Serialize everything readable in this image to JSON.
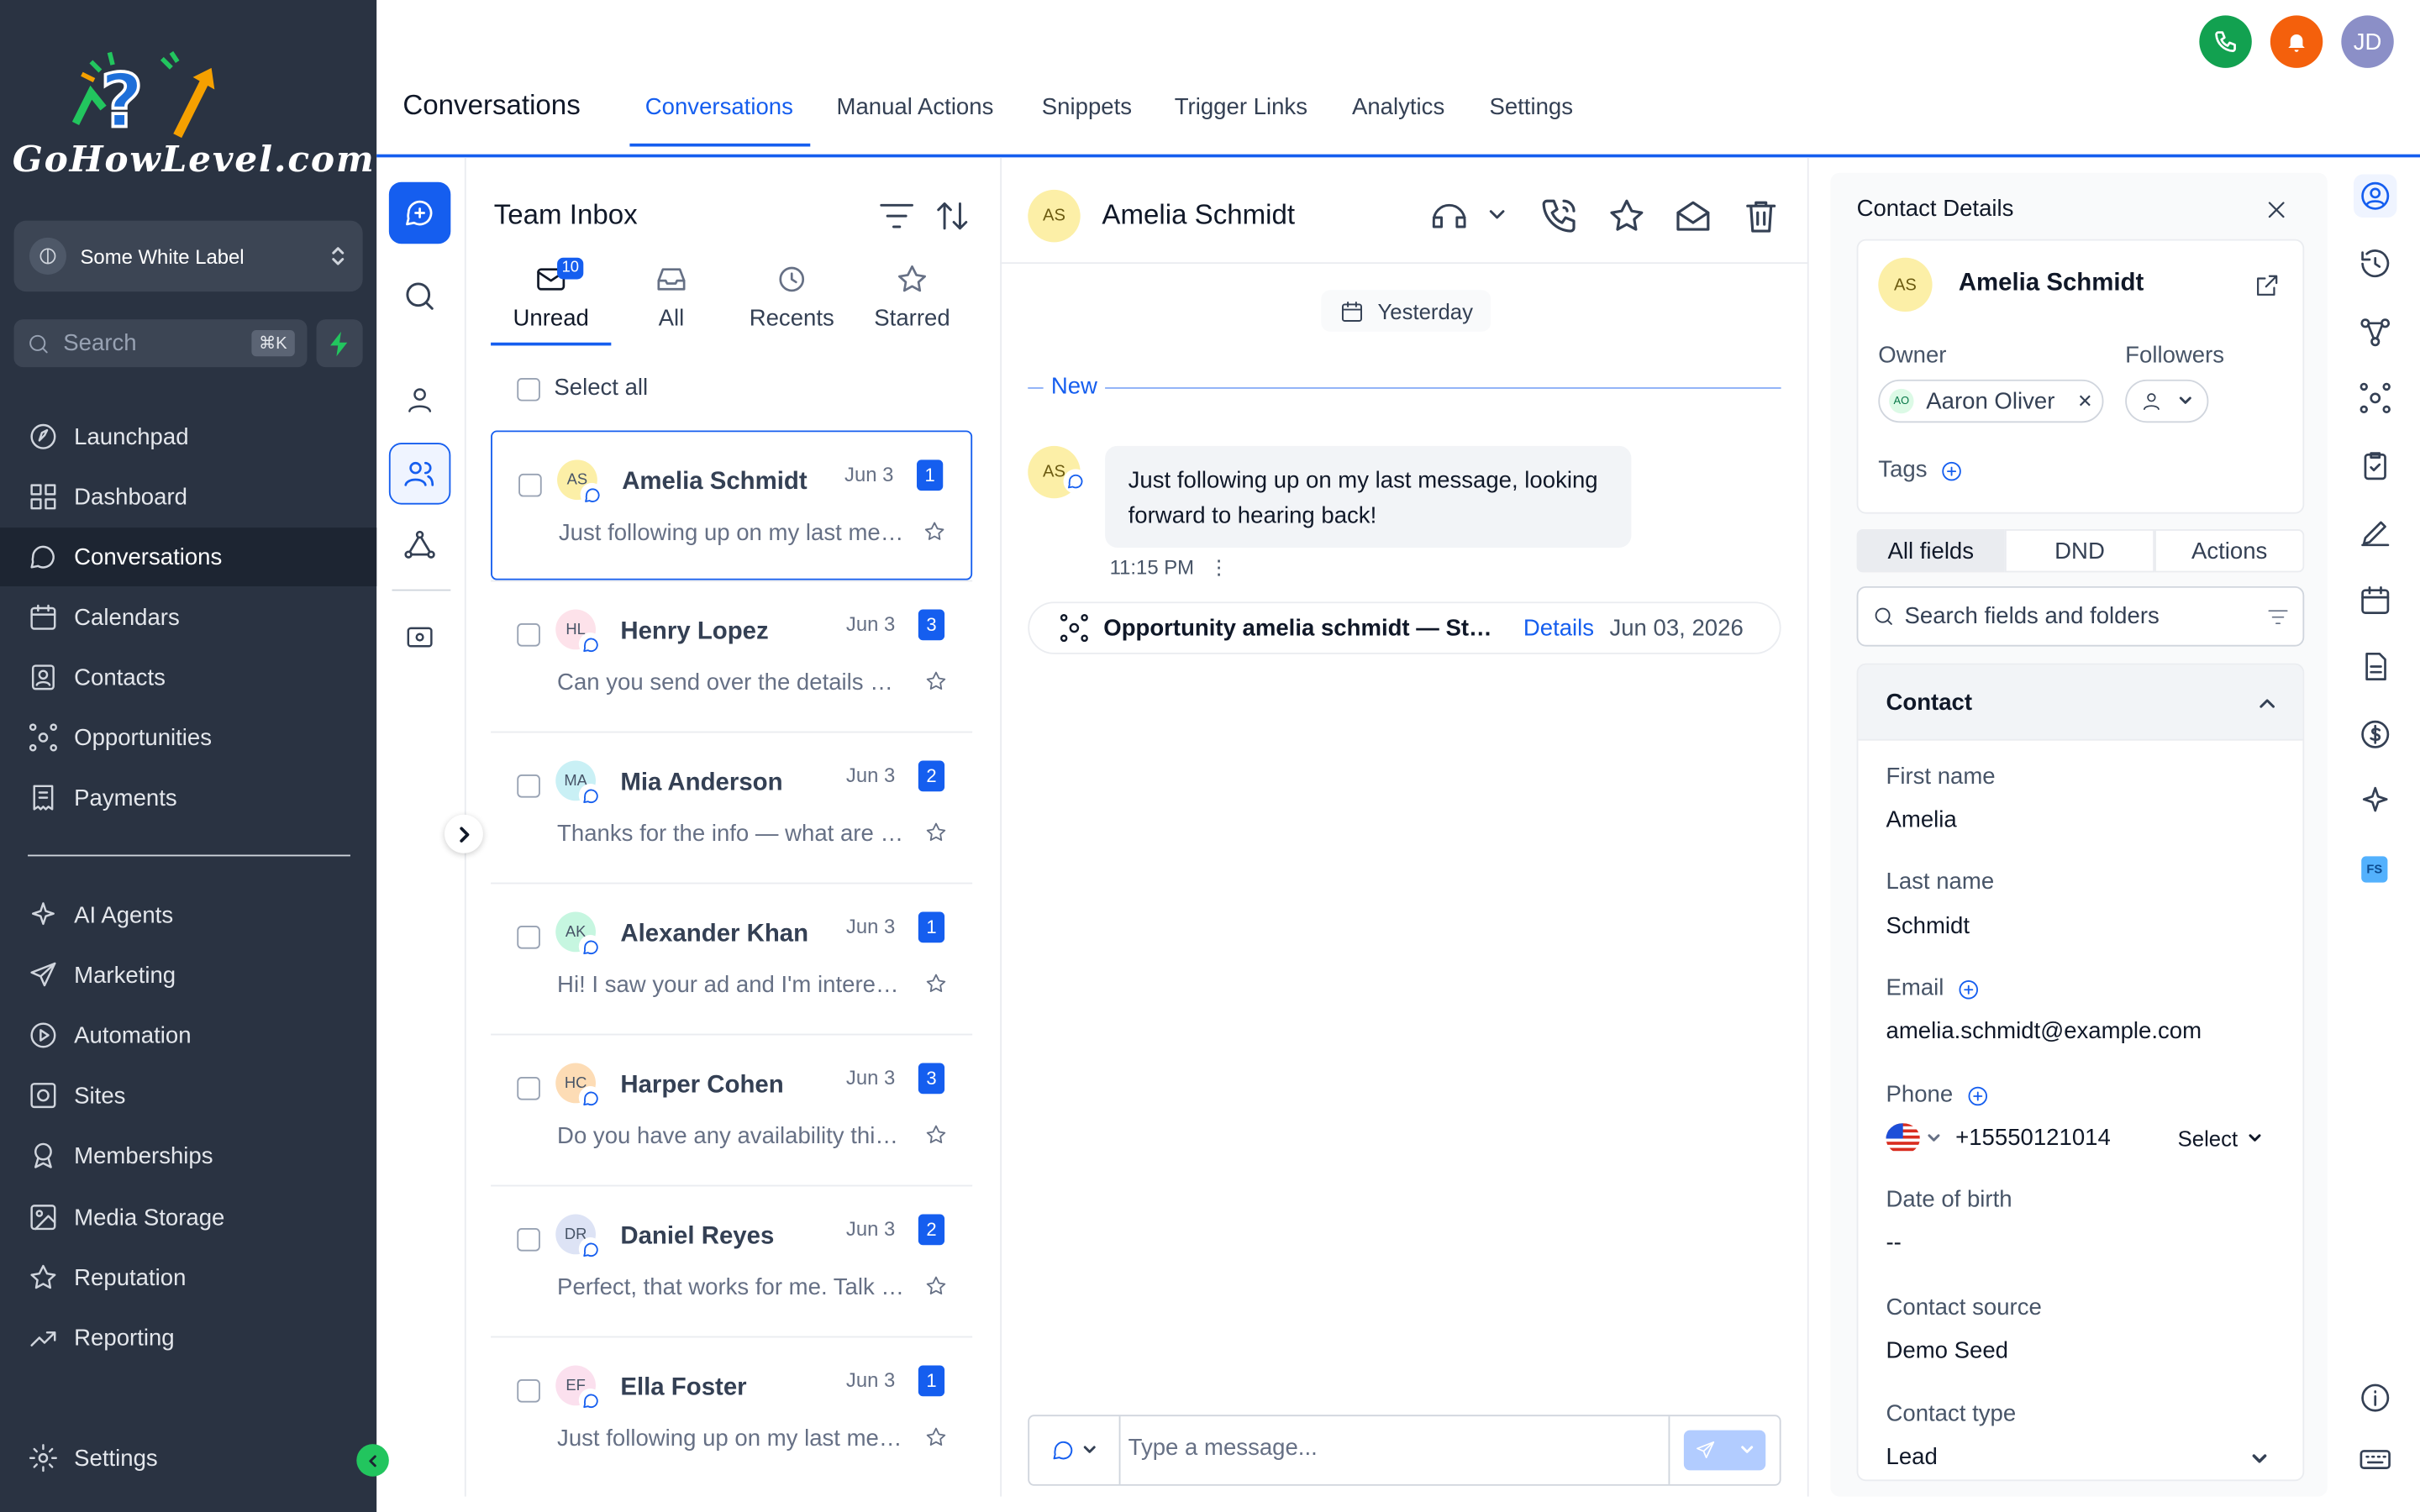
{
  "brand": {
    "logo_text": "GoHowLevel.com"
  },
  "workspace": {
    "name": "Some White Label"
  },
  "sidebar": {
    "search_placeholder": "Search",
    "search_shortcut": "⌘K",
    "items": [
      {
        "label": "Launchpad",
        "icon": "rocket-icon"
      },
      {
        "label": "Dashboard",
        "icon": "grid-icon"
      },
      {
        "label": "Conversations",
        "icon": "chat-icon",
        "active": true
      },
      {
        "label": "Calendars",
        "icon": "calendar-icon"
      },
      {
        "label": "Contacts",
        "icon": "contacts-icon"
      },
      {
        "label": "Opportunities",
        "icon": "pipeline-icon"
      },
      {
        "label": "Payments",
        "icon": "invoice-icon"
      }
    ],
    "items2": [
      {
        "label": "AI Agents",
        "icon": "sparkle-icon"
      },
      {
        "label": "Marketing",
        "icon": "send-icon"
      },
      {
        "label": "Automation",
        "icon": "automation-icon"
      },
      {
        "label": "Sites",
        "icon": "globe-icon"
      },
      {
        "label": "Memberships",
        "icon": "badge-icon"
      },
      {
        "label": "Media Storage",
        "icon": "image-icon"
      },
      {
        "label": "Reputation",
        "icon": "star-icon"
      },
      {
        "label": "Reporting",
        "icon": "trend-icon"
      }
    ],
    "settings_label": "Settings"
  },
  "header": {
    "title": "Conversations",
    "tabs": [
      "Conversations",
      "Manual Actions",
      "Snippets",
      "Trigger Links",
      "Analytics",
      "Settings"
    ],
    "user_initials": "JD",
    "colors": {
      "phone": "#12a150",
      "bell": "#f4600c",
      "avatar": "#8b8fc7"
    }
  },
  "inbox": {
    "title": "Team Inbox",
    "filters": [
      "Unread",
      "All",
      "Recents",
      "Starred"
    ],
    "unread_count": "10",
    "select_all": "Select all",
    "conversations": [
      {
        "initials": "AS",
        "name": "Amelia Schmidt",
        "date": "Jun 3",
        "count": "1",
        "preview": "Just following up on my last message, looking forward to hearing back!",
        "avatar_bg": "#fcefa7"
      },
      {
        "initials": "HL",
        "name": "Henry Lopez",
        "date": "Jun 3",
        "count": "3",
        "preview": "Can you send over the details on pricing?",
        "avatar_bg": "#fde2ea"
      },
      {
        "initials": "MA",
        "name": "Mia Anderson",
        "date": "Jun 3",
        "count": "2",
        "preview": "Thanks for the info — what are the next steps?",
        "avatar_bg": "#c9f0f5"
      },
      {
        "initials": "AK",
        "name": "Alexander Khan",
        "date": "Jun 3",
        "count": "1",
        "preview": "Hi! I saw your ad and I'm interested in learning more.",
        "avatar_bg": "#c6f6e0"
      },
      {
        "initials": "HC",
        "name": "Harper Cohen",
        "date": "Jun 3",
        "count": "3",
        "preview": "Do you have any availability this week?",
        "avatar_bg": "#fddcb5"
      },
      {
        "initials": "DR",
        "name": "Daniel Reyes",
        "date": "Jun 3",
        "count": "2",
        "preview": "Perfect, that works for me. Talk soon!",
        "avatar_bg": "#dde3f5"
      },
      {
        "initials": "EF",
        "name": "Ella Foster",
        "date": "Jun 3",
        "count": "1",
        "preview": "Just following up on my last message, looking forward to hearing back!",
        "avatar_bg": "#fbe0ee"
      }
    ]
  },
  "chat": {
    "initials": "AS",
    "name": "Amelia Schmidt",
    "date_divider": "Yesterday",
    "new_label": "New",
    "message_avatar": "AS",
    "message": "Just following up on my last message, looking forward to hearing back!",
    "message_time": "11:15 PM",
    "opportunity_title": "Opportunity amelia schmidt — Standard",
    "opportunity_link": "Details",
    "opportunity_date": "Jun 03, 2026",
    "composer_placeholder": "Type a message..."
  },
  "contact": {
    "panel_title": "Contact Details",
    "initials": "AS",
    "name": "Amelia Schmidt",
    "owner_label": "Owner",
    "owner_initials": "AO",
    "owner_name": "Aaron Oliver",
    "followers_label": "Followers",
    "tags_label": "Tags",
    "segments": [
      "All fields",
      "DND",
      "Actions"
    ],
    "search_placeholder": "Search fields and folders",
    "section_title": "Contact",
    "fields": {
      "first_name_label": "First name",
      "first_name": "Amelia",
      "last_name_label": "Last name",
      "last_name": "Schmidt",
      "email_label": "Email",
      "email": "amelia.schmidt@example.com",
      "phone_label": "Phone",
      "phone": "+15550121014",
      "phone_type": "Select",
      "dob_label": "Date of birth",
      "dob": "--",
      "source_label": "Contact source",
      "source": "Demo Seed",
      "type_label": "Contact type",
      "type": "Lead"
    }
  },
  "right_rail": {
    "fs_badge": "FS"
  }
}
